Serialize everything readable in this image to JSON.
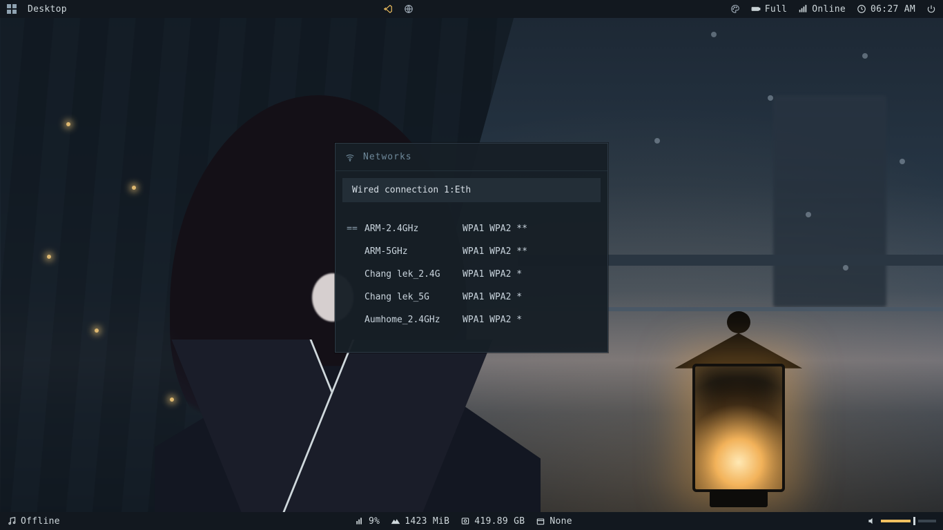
{
  "topbar": {
    "workspace_label": "Desktop",
    "battery_label": "Full",
    "net_label": "Online",
    "clock_label": "06:27 AM"
  },
  "bottombar": {
    "music_label": "Offline",
    "cpu_label": "9%",
    "ram_label": "1423 MiB",
    "disk_label": "419.89 GB",
    "updates_label": "None"
  },
  "volume": {
    "percent": 62
  },
  "popup": {
    "title": "Networks",
    "selected": "Wired connection 1:Eth",
    "items": [
      {
        "connected": true,
        "ssid": "ARM-2.4GHz",
        "security": "WPA1 WPA2 **"
      },
      {
        "connected": false,
        "ssid": "ARM-5GHz",
        "security": "WPA1 WPA2 **"
      },
      {
        "connected": false,
        "ssid": "Chang lek_2.4G",
        "security": "WPA1 WPA2 *"
      },
      {
        "connected": false,
        "ssid": "Chang lek_5G",
        "security": "WPA1 WPA2 *"
      },
      {
        "connected": false,
        "ssid": "Aumhome_2.4GHz",
        "security": "WPA1 WPA2 *"
      }
    ]
  }
}
